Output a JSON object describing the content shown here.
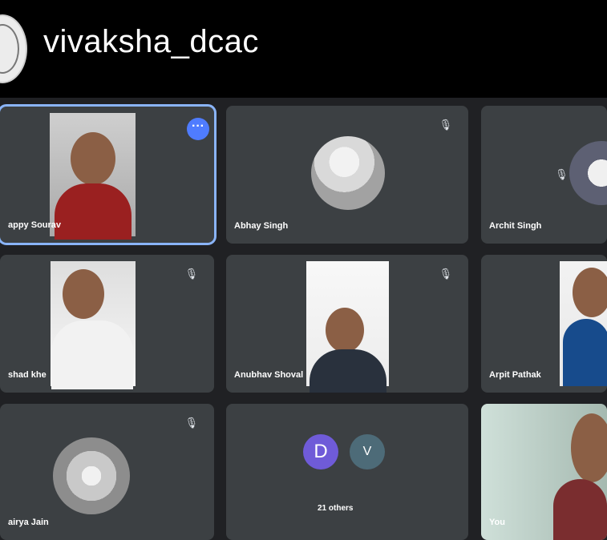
{
  "meeting": {
    "title": "vivaksha_dcac",
    "bubbles": [
      "D",
      "V"
    ],
    "others_label": "21 others"
  },
  "participants": [
    {
      "name": "appy Sourav"
    },
    {
      "name": "Abhay Singh"
    },
    {
      "name": "Archit Singh"
    },
    {
      "name": "shad khe"
    },
    {
      "name": "Anubhav Shoval"
    },
    {
      "name": "Arpit Pathak"
    },
    {
      "name": "airya Jain"
    },
    {
      "name": "You"
    }
  ],
  "icons": {
    "more": "more-options-icon",
    "mic": "mic-off-icon"
  },
  "colors": {
    "background": "#202124",
    "tile": "#3c4043",
    "accent": "#8ab4f8",
    "bubble_d": "#6f5bd8",
    "bubble_v": "#4d6b78"
  }
}
